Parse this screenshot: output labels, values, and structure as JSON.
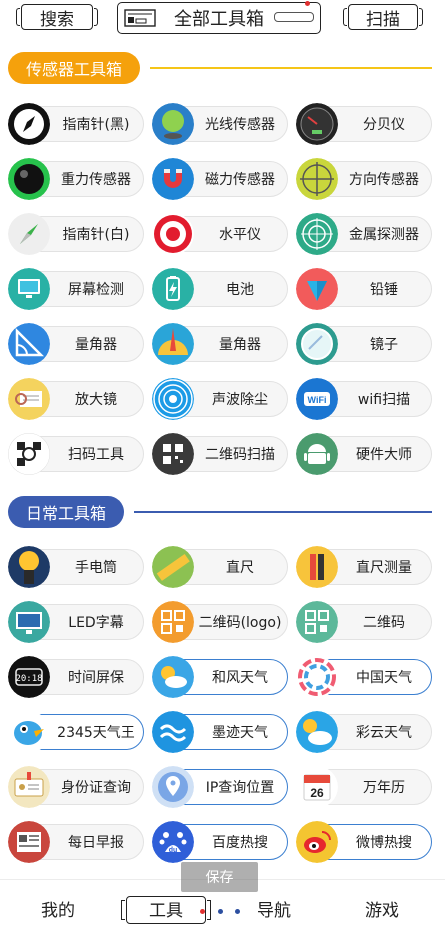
{
  "header": {
    "search_label": "搜索",
    "title": "全部工具箱",
    "scan_label": "扫描"
  },
  "sensor_section": {
    "title": "传感器工具箱",
    "color": "#f5a10c"
  },
  "sensor_tools": [
    {
      "label": "指南针(黑)",
      "icon": "compass-black-icon"
    },
    {
      "label": "光线传感器",
      "icon": "light-sensor-icon"
    },
    {
      "label": "分贝仪",
      "icon": "decibel-meter-icon"
    },
    {
      "label": "重力传感器",
      "icon": "gravity-ball-icon"
    },
    {
      "label": "磁力传感器",
      "icon": "magnet-icon"
    },
    {
      "label": "方向传感器",
      "icon": "crosshair-icon"
    },
    {
      "label": "指南针(白)",
      "icon": "compass-white-icon"
    },
    {
      "label": "水平仪",
      "icon": "target-icon"
    },
    {
      "label": "金属探测器",
      "icon": "radar-icon"
    },
    {
      "label": "屏幕检测",
      "icon": "monitor-check-icon"
    },
    {
      "label": "电池",
      "icon": "battery-icon"
    },
    {
      "label": "铅锤",
      "icon": "plumb-icon"
    },
    {
      "label": "量角器",
      "icon": "protractor-icon"
    },
    {
      "label": "量角器",
      "icon": "triangle-ruler-icon"
    },
    {
      "label": "镜子",
      "icon": "mirror-icon"
    },
    {
      "label": "放大镜",
      "icon": "magnifier-icon"
    },
    {
      "label": "声波除尘",
      "icon": "soundwave-icon"
    },
    {
      "label": "wifi扫描",
      "icon": "wifi-icon"
    },
    {
      "label": "扫码工具",
      "icon": "scan-code-icon"
    },
    {
      "label": "二维码扫描",
      "icon": "qr-scan-icon"
    },
    {
      "label": "硬件大师",
      "icon": "android-icon"
    }
  ],
  "daily_section": {
    "title": "日常工具箱",
    "color": "#3b5cb0"
  },
  "daily_tools": [
    {
      "label": "手电筒",
      "icon": "flashlight-icon"
    },
    {
      "label": "直尺",
      "icon": "ruler-icon"
    },
    {
      "label": "直尺测量",
      "icon": "ruler-measure-icon"
    },
    {
      "label": "LED字幕",
      "icon": "led-screen-icon"
    },
    {
      "label": "二维码(logo)",
      "icon": "qr-logo-icon"
    },
    {
      "label": "二维码",
      "icon": "qr-code-icon"
    },
    {
      "label": "时间屏保",
      "icon": "clock-screen-icon"
    },
    {
      "label": "和风天气",
      "icon": "weather-sun-cloud-icon"
    },
    {
      "label": "中国天气",
      "icon": "china-weather-icon"
    },
    {
      "label": "2345天气王",
      "icon": "bird-weather-icon"
    },
    {
      "label": "墨迹天气",
      "icon": "moji-weather-icon"
    },
    {
      "label": "彩云天气",
      "icon": "caiyun-weather-icon"
    },
    {
      "label": "身份证查询",
      "icon": "id-card-icon"
    },
    {
      "label": "IP查询位置",
      "icon": "location-pin-icon"
    },
    {
      "label": "万年历",
      "icon": "calendar-icon"
    },
    {
      "label": "每日早报",
      "icon": "newspaper-icon"
    },
    {
      "label": "百度热搜",
      "icon": "baidu-icon"
    },
    {
      "label": "微博热搜",
      "icon": "weibo-icon"
    }
  ],
  "calendar_day": "26",
  "clock_text": "20:18",
  "toast": "保存",
  "nav": {
    "mine": "我的",
    "tools": "工具",
    "navigation": "导航",
    "games": "游戏"
  }
}
